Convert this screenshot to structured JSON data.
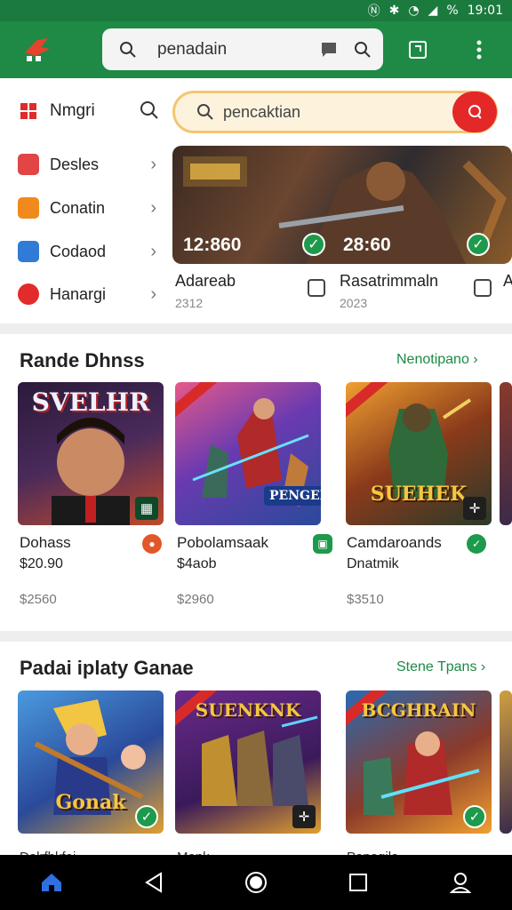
{
  "status": {
    "time": "19:01",
    "battery": "%"
  },
  "appbar": {
    "search_text": "penadain"
  },
  "menu": {
    "head_label": "Nmgri",
    "items": [
      {
        "label": "Desles",
        "color": "#e24545"
      },
      {
        "label": "Conatin",
        "color": "#f08a1c"
      },
      {
        "label": "Codaod",
        "color": "#2f7bd5"
      },
      {
        "label": "Hanargi",
        "color": "#e22b2b"
      }
    ]
  },
  "search": {
    "placeholder": "pencaktian"
  },
  "banner": {
    "time_left": "12:860",
    "time_right": "28:60"
  },
  "captions": [
    {
      "name": "Adareab",
      "num": "2312"
    },
    {
      "name": "Rasatrimmaln",
      "num": "2023"
    },
    {
      "name": "A"
    }
  ],
  "section1": {
    "title": "Rande Dhnss",
    "link": "Nenotipano ›",
    "games": [
      {
        "cover": "SVELHR",
        "name": "Dohass",
        "sub": "$20.90",
        "price": "$2560",
        "tag_color": "#e2572a"
      },
      {
        "cover": "PENGER",
        "name": "Pobolamsaak",
        "sub": "$4aob",
        "price": "$2960",
        "tag_color": "#1d9a4b"
      },
      {
        "cover": "SUEHEK",
        "name": "Camdaroands",
        "sub": "Dnatmik",
        "price": "$3510",
        "tag_color": "#1d9a4b"
      }
    ]
  },
  "section2": {
    "title": "Padai iplaty Ganae",
    "link": "Stene Tpans ›",
    "games": [
      {
        "cover": "Gonak",
        "name": "Dolrfbkfei"
      },
      {
        "cover": "SUENKNK",
        "name": "Monk"
      },
      {
        "cover": "BCGHRAIN",
        "name": "Popegilo"
      }
    ]
  },
  "icons": {
    "home": "home-icon",
    "back": "back-icon",
    "homecircle": "home-circle-icon",
    "recents": "recents-icon"
  }
}
